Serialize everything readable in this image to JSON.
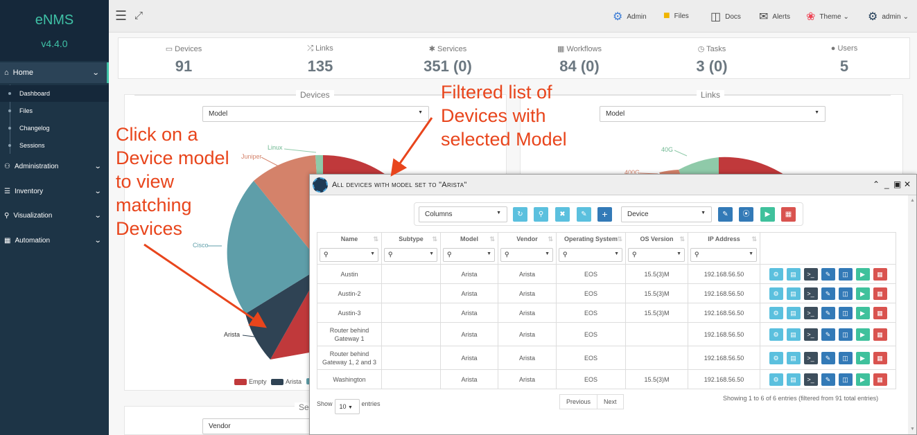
{
  "brand": {
    "name": "eNMS",
    "version": "v4.4.0"
  },
  "sidebar": {
    "home": "Home",
    "sub": [
      "Dashboard",
      "Files",
      "Changelog",
      "Sessions"
    ],
    "items": [
      "Administration",
      "Inventory",
      "Visualization",
      "Automation"
    ]
  },
  "topbar": {
    "admin": "Admin",
    "files": "Files",
    "docs": "Docs",
    "alerts": "Alerts",
    "theme": "Theme",
    "user": "admin"
  },
  "stats": [
    {
      "label": "Devices",
      "value": "91"
    },
    {
      "label": "Links",
      "value": "135"
    },
    {
      "label": "Services",
      "value": "351 (0)"
    },
    {
      "label": "Workflows",
      "value": "84 (0)"
    },
    {
      "label": "Tasks",
      "value": "3 (0)"
    },
    {
      "label": "Users",
      "value": "5"
    }
  ],
  "panels": {
    "devices": {
      "title": "Devices",
      "select": "Model",
      "labels": {
        "linux": "Linux",
        "juniper": "Juniper",
        "cisco": "Cisco",
        "arista": "Arista"
      },
      "legend": [
        "Empty",
        "Arista"
      ]
    },
    "links": {
      "title": "Links",
      "select": "Model",
      "labels": {
        "g40": "40G",
        "g400": "400G"
      }
    },
    "bottom": {
      "title": "Se",
      "select": "Vendor"
    }
  },
  "colors": {
    "red": "#c0393b",
    "dark": "#2f4354",
    "teal": "#5e9ea9",
    "salmon": "#d4826a",
    "mint": "#8fcaa9",
    "accent": "#3fc1a6"
  },
  "annotations": {
    "left": [
      "Click on a",
      "Device model",
      "to view",
      "matching",
      "Devices"
    ],
    "right": [
      "Filtered list of",
      "Devices with",
      "selected Model"
    ]
  },
  "modal": {
    "title": "All devices with model set to \"Arista\"",
    "columns_select": "Columns",
    "type_select": "Device",
    "headers": [
      "Name",
      "Subtype",
      "Model",
      "Vendor",
      "Operating System",
      "OS Version",
      "IP Address"
    ],
    "rows": [
      {
        "name": "Austin",
        "subtype": "",
        "model": "Arista",
        "vendor": "Arista",
        "os": "EOS",
        "version": "15.5(3)M",
        "ip": "192.168.56.50"
      },
      {
        "name": "Austin-2",
        "subtype": "",
        "model": "Arista",
        "vendor": "Arista",
        "os": "EOS",
        "version": "15.5(3)M",
        "ip": "192.168.56.50"
      },
      {
        "name": "Austin-3",
        "subtype": "",
        "model": "Arista",
        "vendor": "Arista",
        "os": "EOS",
        "version": "15.5(3)M",
        "ip": "192.168.56.50"
      },
      {
        "name": "Router behind Gateway 1",
        "subtype": "",
        "model": "Arista",
        "vendor": "Arista",
        "os": "EOS",
        "version": "",
        "ip": "192.168.56.50"
      },
      {
        "name": "Router behind Gateway 1, 2 and 3",
        "subtype": "",
        "model": "Arista",
        "vendor": "Arista",
        "os": "EOS",
        "version": "",
        "ip": "192.168.56.50"
      },
      {
        "name": "Washington",
        "subtype": "",
        "model": "Arista",
        "vendor": "Arista",
        "os": "EOS",
        "version": "15.5(3)M",
        "ip": "192.168.56.50"
      }
    ],
    "show": "Show",
    "length": "10",
    "entries": "entries",
    "previous": "Previous",
    "next": "Next",
    "info": "Showing 1 to 6 of 6 entries (filtered from 91 total entries)"
  }
}
